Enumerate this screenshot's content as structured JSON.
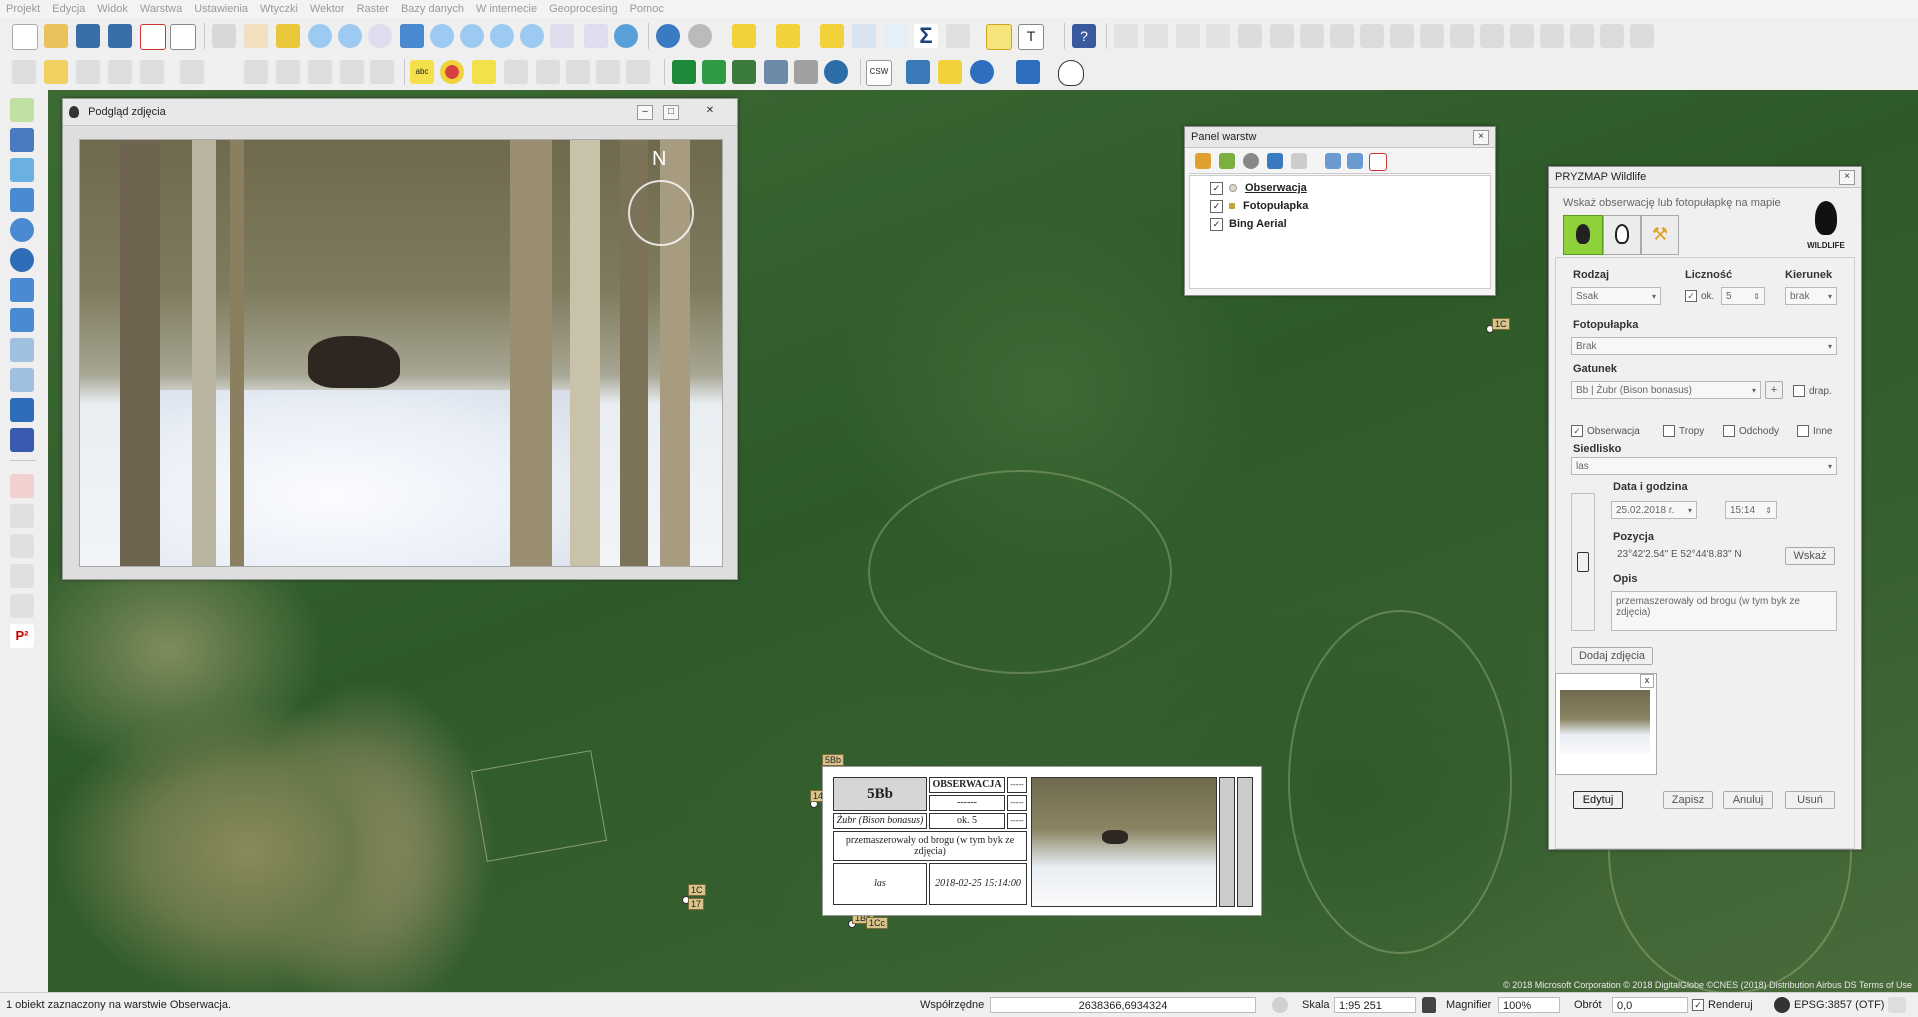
{
  "menu": [
    "Projekt",
    "Edycja",
    "Widok",
    "Warstwa",
    "Ustawienia",
    "Wtyczki",
    "Wektor",
    "Raster",
    "Bazy danych",
    "W internecie",
    "Geoprocesing",
    "Pomoc"
  ],
  "toolbar2": {
    "csw_label": "CSW",
    "abc_label": "abc"
  },
  "photo_window": {
    "title": "Podgląd zdjęcia",
    "compass_label": "N"
  },
  "layers_panel": {
    "title": "Panel warstw",
    "layers": [
      {
        "name": "Obserwacja",
        "checked": true,
        "dot_color": "#e0d8c0"
      },
      {
        "name": "Fotopułapka",
        "checked": true,
        "dot_color": "#c8a040"
      },
      {
        "name": "Bing Aerial",
        "checked": true,
        "dot_color": ""
      }
    ]
  },
  "pryzmap": {
    "title": "PRYZMAP Wildlife",
    "hint": "Wskaż obserwację lub fotopułapkę na mapie",
    "logo_text": "WILDLIFE",
    "rodzaj_label": "Rodzaj",
    "rodzaj_value": "Ssak",
    "licznosc_label": "Liczność",
    "licznosc_ok": "ok.",
    "licznosc_value": "5",
    "kierunek_label": "Kierunek",
    "kierunek_value": "brak",
    "fotopulapka_label": "Fotopułapka",
    "fotopulapka_value": "Brak",
    "gatunek_label": "Gatunek",
    "gatunek_value": "Bb | Żubr (Bison bonasus)",
    "drap_label": "drap.",
    "obserwacja_label": "Obserwacja",
    "tropy_label": "Tropy",
    "odchody_label": "Odchody",
    "inne_label": "Inne",
    "siedlisko_label": "Siedlisko",
    "siedlisko_value": "las",
    "data_label": "Data i godzina",
    "date_value": "25.02.2018 r.",
    "time_value": "15:14",
    "pozycja_label": "Pozycja",
    "pozycja_value": "23°42'2.54\" E  52°44'8.83\" N",
    "wskaz_label": "Wskaż",
    "opis_label": "Opis",
    "opis_value": "przemaszerowały od brogu (w tym byk ze zdjęcia)",
    "dodaj_zdjecia_label": "Dodaj zdjęcia",
    "thumb_close": "x",
    "edytuj_label": "Edytuj",
    "zapisz_label": "Zapisz",
    "anuluj_label": "Anuluj",
    "usun_label": "Usuń"
  },
  "obs_card": {
    "code": "5Bb",
    "header": "OBSERWACJA",
    "dash": "------",
    "short_dash": "-----",
    "species": "Żubr (Bison bonasus)",
    "count": "ok. 5",
    "description": "przemaszerowały od brogu (w tym byk ze zdjęcia)",
    "habitat": "las",
    "datetime": "2018-02-25 15:14:00"
  },
  "map_labels": {
    "l1": "1C",
    "l2": "5Bb",
    "l3": "1C",
    "l4": "17",
    "l5": "1Bc",
    "l6": "1Cc",
    "l7": "14",
    "copyright": "© 2018 Microsoft Corporation © 2018 DigitalGlobe ©CNES (2018) Distribution Airbus DS Terms of Use"
  },
  "statusbar": {
    "message": "1 obiekt zaznaczony na warstwie Obserwacja.",
    "coords_label": "Współrzędne",
    "coords_value": "2638366,6934324",
    "scale_label": "Skala",
    "scale_value": "1:95 251",
    "magnifier_label": "Magnifier",
    "magnifier_value": "100%",
    "rotation_label": "Obrót",
    "rotation_value": "0,0",
    "render_label": "Renderuj",
    "crs_label": "EPSG:3857 (OTF)"
  },
  "colors": {
    "accent_green": "#8ed13a",
    "map_green": "#2f5b2a"
  }
}
